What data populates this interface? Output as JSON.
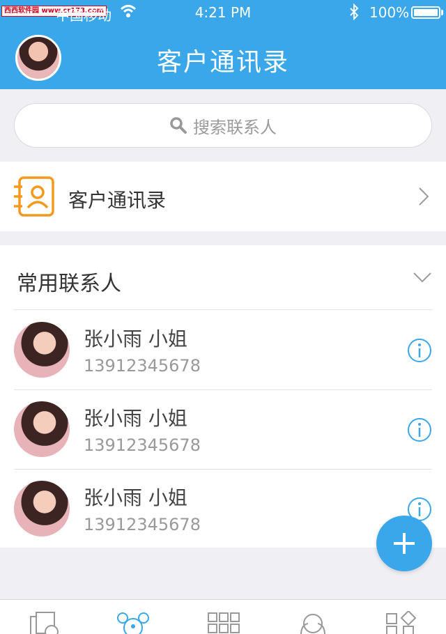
{
  "status_bar": {
    "watermark": "西西软件园 www.cr173.com",
    "carrier": "中国移动",
    "time": "4:21 PM",
    "battery": "100%"
  },
  "header": {
    "title": "客户通讯录"
  },
  "search": {
    "placeholder": "搜索联系人"
  },
  "directory": {
    "label": "客户通讯录"
  },
  "frequent": {
    "title": "常用联系人",
    "contacts": [
      {
        "name": "张小雨  小姐",
        "phone": "13912345678"
      },
      {
        "name": "张小雨  小姐",
        "phone": "13912345678"
      },
      {
        "name": "张小雨  小姐",
        "phone": "13912345678"
      }
    ]
  },
  "colors": {
    "accent": "#3aa7ea",
    "directory_icon": "#f39a1e"
  },
  "tabs": [
    {
      "icon": "cards-icon",
      "active": false
    },
    {
      "icon": "contacts-icon",
      "active": true
    },
    {
      "icon": "grid-icon",
      "active": false
    },
    {
      "icon": "group-icon",
      "active": false
    },
    {
      "icon": "apps-icon",
      "active": false
    }
  ]
}
